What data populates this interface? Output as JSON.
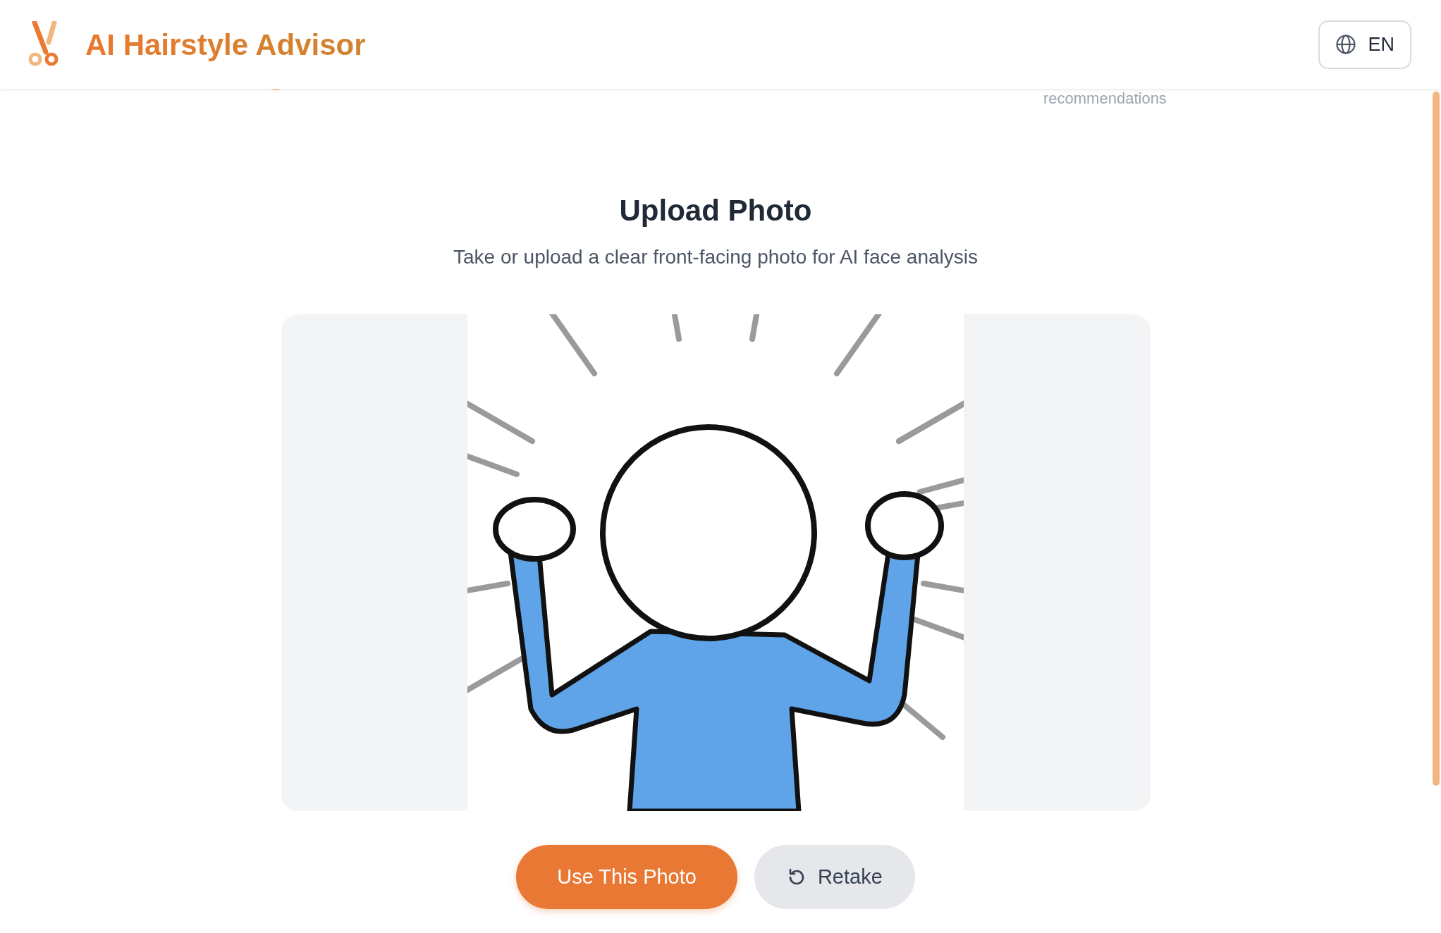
{
  "header": {
    "title": "AI Hairstyle Advisor",
    "language_button": "EN"
  },
  "stepper": {
    "step_text": "recommendations"
  },
  "upload": {
    "title": "Upload Photo",
    "subtitle": "Take or upload a clear front-facing photo for AI face analysis"
  },
  "buttons": [
    {
      "label": "Use This Photo",
      "kind": "primary"
    },
    {
      "label": "Retake",
      "kind": "secondary"
    }
  ]
}
